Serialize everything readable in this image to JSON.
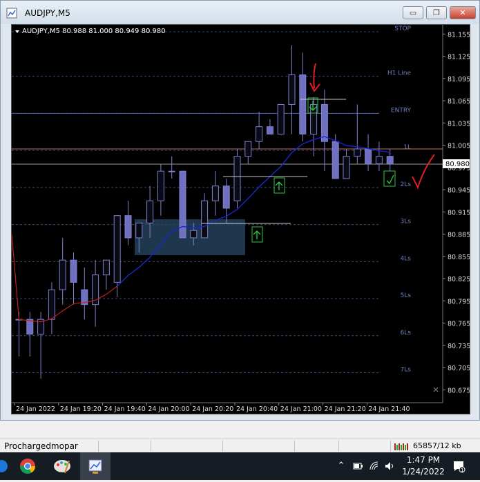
{
  "window": {
    "title": "AUDJPY,M5",
    "minimize_label": "▭",
    "maximize_label": "❐",
    "close_label": "✕"
  },
  "chart": {
    "header": "AUDJPY,M5  80.988 81.000 80.949 80.980",
    "current_price": "80.980",
    "price_labels": [
      "81.155",
      "81.125",
      "81.095",
      "81.065",
      "81.035",
      "81.005",
      "80.975",
      "80.945",
      "80.915",
      "80.885",
      "80.855",
      "80.825",
      "80.795",
      "80.765",
      "80.735",
      "80.705",
      "80.675"
    ],
    "time_labels": [
      "24 Jan 2022",
      "24 Jan 19:20",
      "24 Jan 19:40",
      "24 Jan 20:00",
      "24 Jan 20:20",
      "24 Jan 20:40",
      "24 Jan 21:00",
      "24 Jan 21:20",
      "24 Jan 21:40"
    ],
    "level_labels": [
      "STOP",
      "H1 Line",
      "ENTRY",
      "1L",
      "2Ls",
      "3Ls",
      "4Ls",
      "5Ls",
      "6Ls",
      "7Ls"
    ],
    "colors": {
      "bull": "#0a0a14",
      "bear": "#7070c0",
      "wick": "#8080d0",
      "grid": "#3a4a7a",
      "ma_red": "#c0201a",
      "ma_blue": "#1828d0",
      "arrow": "#2ecc40",
      "mark": "#e02020"
    }
  },
  "chart_data": {
    "type": "candlestick",
    "title": "AUDJPY,M5",
    "ohlc_header": {
      "open": 80.988,
      "high": 81.0,
      "low": 80.949,
      "close": 80.98
    },
    "ylim": [
      80.665,
      81.16
    ],
    "levels": [
      {
        "name": "STOP",
        "price": 81.158
      },
      {
        "name": "H1 Line",
        "price": 81.098
      },
      {
        "name": "ENTRY",
        "price": 81.048
      },
      {
        "name": "1L",
        "price": 80.998
      },
      {
        "name": "2Ls",
        "price": 80.948
      },
      {
        "name": "3Ls",
        "price": 80.898
      },
      {
        "name": "4Ls",
        "price": 80.848
      },
      {
        "name": "5Ls",
        "price": 80.798
      },
      {
        "name": "6Ls",
        "price": 80.748
      },
      {
        "name": "7Ls",
        "price": 80.698
      }
    ],
    "candles": [
      {
        "o": 80.77,
        "h": 80.78,
        "l": 80.72,
        "c": 80.77
      },
      {
        "o": 80.77,
        "h": 80.78,
        "l": 80.72,
        "c": 80.75
      },
      {
        "o": 80.75,
        "h": 80.78,
        "l": 80.69,
        "c": 80.77
      },
      {
        "o": 80.77,
        "h": 80.82,
        "l": 80.75,
        "c": 80.81
      },
      {
        "o": 80.81,
        "h": 80.88,
        "l": 80.79,
        "c": 80.85
      },
      {
        "o": 80.85,
        "h": 80.86,
        "l": 80.79,
        "c": 80.82
      },
      {
        "o": 80.81,
        "h": 80.84,
        "l": 80.77,
        "c": 80.79
      },
      {
        "o": 80.79,
        "h": 80.85,
        "l": 80.76,
        "c": 80.83
      },
      {
        "o": 80.83,
        "h": 80.85,
        "l": 80.81,
        "c": 80.85
      },
      {
        "o": 80.82,
        "h": 80.91,
        "l": 80.8,
        "c": 80.91
      },
      {
        "o": 80.91,
        "h": 80.93,
        "l": 80.87,
        "c": 80.88
      },
      {
        "o": 80.88,
        "h": 80.9,
        "l": 80.86,
        "c": 80.9
      },
      {
        "o": 80.9,
        "h": 80.95,
        "l": 80.88,
        "c": 80.93
      },
      {
        "o": 80.93,
        "h": 80.98,
        "l": 80.91,
        "c": 80.97
      },
      {
        "o": 80.97,
        "h": 80.99,
        "l": 80.96,
        "c": 80.97
      },
      {
        "o": 80.97,
        "h": 80.97,
        "l": 80.88,
        "c": 80.88
      },
      {
        "o": 80.88,
        "h": 80.9,
        "l": 80.87,
        "c": 80.89
      },
      {
        "o": 80.88,
        "h": 80.94,
        "l": 80.88,
        "c": 80.93
      },
      {
        "o": 80.93,
        "h": 80.97,
        "l": 80.91,
        "c": 80.95
      },
      {
        "o": 80.95,
        "h": 80.96,
        "l": 80.9,
        "c": 80.92
      },
      {
        "o": 80.93,
        "h": 81.0,
        "l": 80.92,
        "c": 80.99
      },
      {
        "o": 80.99,
        "h": 81.01,
        "l": 80.98,
        "c": 81.01
      },
      {
        "o": 81.01,
        "h": 81.05,
        "l": 81.0,
        "c": 81.03
      },
      {
        "o": 81.03,
        "h": 81.04,
        "l": 81.02,
        "c": 81.02
      },
      {
        "o": 81.02,
        "h": 81.06,
        "l": 81.02,
        "c": 81.06
      },
      {
        "o": 81.06,
        "h": 81.14,
        "l": 81.02,
        "c": 81.1
      },
      {
        "o": 81.1,
        "h": 81.13,
        "l": 81.01,
        "c": 81.02
      },
      {
        "o": 81.02,
        "h": 81.07,
        "l": 80.99,
        "c": 81.06
      },
      {
        "o": 81.06,
        "h": 81.08,
        "l": 80.97,
        "c": 81.01
      },
      {
        "o": 81.01,
        "h": 81.02,
        "l": 80.96,
        "c": 80.96
      },
      {
        "o": 80.96,
        "h": 81.0,
        "l": 80.96,
        "c": 80.99
      },
      {
        "o": 80.99,
        "h": 81.06,
        "l": 80.98,
        "c": 81.0
      },
      {
        "o": 81.0,
        "h": 81.02,
        "l": 80.97,
        "c": 80.98
      },
      {
        "o": 80.98,
        "h": 81.01,
        "l": 80.97,
        "c": 80.99
      },
      {
        "o": 80.99,
        "h": 81.0,
        "l": 80.97,
        "c": 80.98
      }
    ]
  },
  "status": {
    "profile": "Prochargedmopar",
    "traffic": "65857/12 kb"
  },
  "taskbar": {
    "time": "1:47 PM",
    "date": "1/24/2022"
  }
}
